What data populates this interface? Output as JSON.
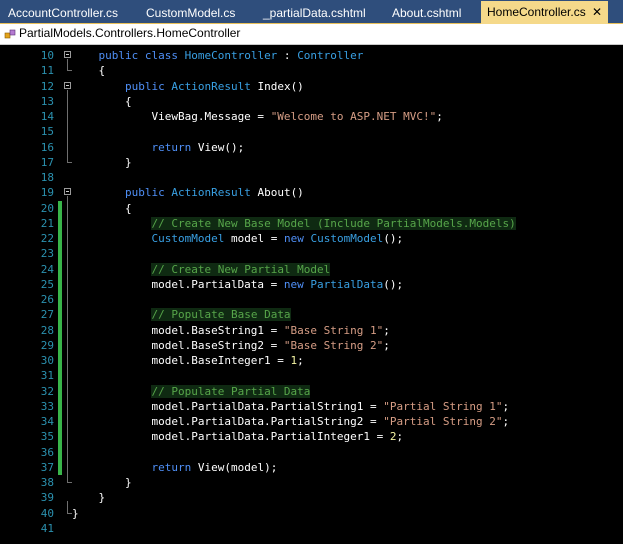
{
  "tabs": [
    {
      "label": "AccountController.cs",
      "active": false
    },
    {
      "label": "CustomModel.cs",
      "active": false
    },
    {
      "label": "_partialData.cshtml",
      "active": false
    },
    {
      "label": "About.cshtml",
      "active": false
    },
    {
      "label": "HomeController.cs",
      "active": true
    }
  ],
  "tab_close_glyph": "✕",
  "navigation": {
    "icon": "class-icon",
    "path": "PartialModels.Controllers.HomeController"
  },
  "colors": {
    "keyword": "#4f8ff6",
    "type": "#39a0e3",
    "string": "#d69d85",
    "comment": "#57a64a",
    "line_number": "#2b91af",
    "change_bar": "#39b54a",
    "active_tab": "#f5d98a",
    "tab_bar": "#2f4e7c"
  },
  "code_lines": [
    {
      "n": "10",
      "tokens": [
        [
          "plain",
          "    "
        ],
        [
          "kw",
          "public class "
        ],
        [
          "type",
          "HomeController"
        ],
        [
          "plain",
          " : "
        ],
        [
          "type",
          "Controller"
        ]
      ]
    },
    {
      "n": "11",
      "tokens": [
        [
          "plain",
          "    {"
        ]
      ]
    },
    {
      "n": "12",
      "tokens": [
        [
          "plain",
          "        "
        ],
        [
          "kw",
          "public "
        ],
        [
          "type",
          "ActionResult"
        ],
        [
          "plain",
          " Index()"
        ]
      ]
    },
    {
      "n": "13",
      "tokens": [
        [
          "plain",
          "        {"
        ]
      ]
    },
    {
      "n": "14",
      "tokens": [
        [
          "plain",
          "            ViewBag.Message = "
        ],
        [
          "str",
          "\"Welcome to ASP.NET MVC!\""
        ],
        [
          "plain",
          ";"
        ]
      ]
    },
    {
      "n": "15",
      "tokens": []
    },
    {
      "n": "16",
      "tokens": [
        [
          "plain",
          "            "
        ],
        [
          "kw",
          "return "
        ],
        [
          "plain",
          "View();"
        ]
      ]
    },
    {
      "n": "17",
      "tokens": [
        [
          "plain",
          "        }"
        ]
      ]
    },
    {
      "n": "18",
      "tokens": []
    },
    {
      "n": "19",
      "tokens": [
        [
          "plain",
          "        "
        ],
        [
          "kw",
          "public "
        ],
        [
          "type",
          "ActionResult"
        ],
        [
          "plain",
          " About()"
        ]
      ]
    },
    {
      "n": "20",
      "tokens": [
        [
          "plain",
          "        {"
        ]
      ]
    },
    {
      "n": "21",
      "tokens": [
        [
          "plain",
          "            "
        ],
        [
          "cmt",
          "// Create New Base Model (Include PartialModels.Models)"
        ]
      ]
    },
    {
      "n": "22",
      "tokens": [
        [
          "plain",
          "            "
        ],
        [
          "type",
          "CustomModel"
        ],
        [
          "plain",
          " model = "
        ],
        [
          "kw",
          "new "
        ],
        [
          "type",
          "CustomModel"
        ],
        [
          "plain",
          "();"
        ]
      ]
    },
    {
      "n": "23",
      "tokens": []
    },
    {
      "n": "24",
      "tokens": [
        [
          "plain",
          "            "
        ],
        [
          "cmt",
          "// Create New Partial Model"
        ]
      ]
    },
    {
      "n": "25",
      "tokens": [
        [
          "plain",
          "            model.PartialData = "
        ],
        [
          "kw",
          "new "
        ],
        [
          "type",
          "PartialData"
        ],
        [
          "plain",
          "();"
        ]
      ]
    },
    {
      "n": "26",
      "tokens": []
    },
    {
      "n": "27",
      "tokens": [
        [
          "plain",
          "            "
        ],
        [
          "cmt",
          "// Populate Base Data"
        ]
      ]
    },
    {
      "n": "28",
      "tokens": [
        [
          "plain",
          "            model.BaseString1 = "
        ],
        [
          "str",
          "\"Base String 1\""
        ],
        [
          "plain",
          ";"
        ]
      ]
    },
    {
      "n": "29",
      "tokens": [
        [
          "plain",
          "            model.BaseString2 = "
        ],
        [
          "str",
          "\"Base String 2\""
        ],
        [
          "plain",
          ";"
        ]
      ]
    },
    {
      "n": "30",
      "tokens": [
        [
          "plain",
          "            model.BaseInteger1 = "
        ],
        [
          "num",
          "1"
        ],
        [
          "plain",
          ";"
        ]
      ]
    },
    {
      "n": "31",
      "tokens": []
    },
    {
      "n": "32",
      "tokens": [
        [
          "plain",
          "            "
        ],
        [
          "cmt",
          "// Populate Partial Data"
        ]
      ]
    },
    {
      "n": "33",
      "tokens": [
        [
          "plain",
          "            model.PartialData.PartialString1 = "
        ],
        [
          "str",
          "\"Partial String 1\""
        ],
        [
          "plain",
          ";"
        ]
      ]
    },
    {
      "n": "34",
      "tokens": [
        [
          "plain",
          "            model.PartialData.PartialString2 = "
        ],
        [
          "str",
          "\"Partial String 2\""
        ],
        [
          "plain",
          ";"
        ]
      ]
    },
    {
      "n": "35",
      "tokens": [
        [
          "plain",
          "            model.PartialData.PartialInteger1 = "
        ],
        [
          "num",
          "2"
        ],
        [
          "plain",
          ";"
        ]
      ]
    },
    {
      "n": "36",
      "tokens": []
    },
    {
      "n": "37",
      "tokens": [
        [
          "plain",
          "            "
        ],
        [
          "kw",
          "return "
        ],
        [
          "plain",
          "View(model);"
        ]
      ]
    },
    {
      "n": "38",
      "tokens": [
        [
          "plain",
          "        }"
        ]
      ]
    },
    {
      "n": "39",
      "tokens": [
        [
          "plain",
          "    }"
        ]
      ]
    },
    {
      "n": "40",
      "tokens": [
        [
          "plain",
          "}"
        ]
      ]
    },
    {
      "n": "41",
      "tokens": []
    }
  ]
}
